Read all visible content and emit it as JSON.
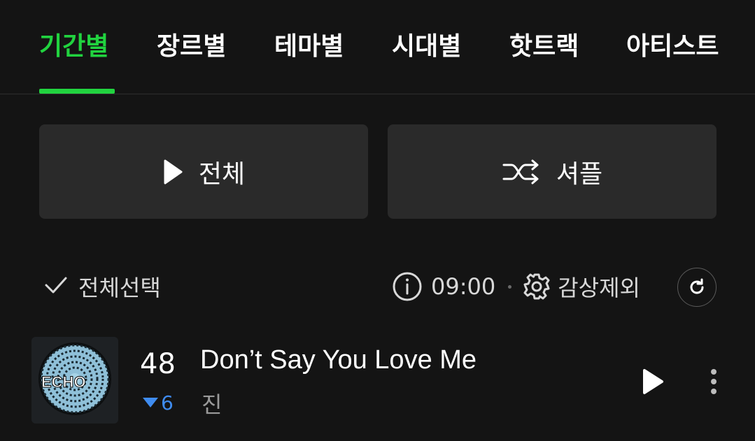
{
  "tabs": [
    {
      "label": "기간별",
      "active": true
    },
    {
      "label": "장르별",
      "active": false
    },
    {
      "label": "테마별",
      "active": false
    },
    {
      "label": "시대별",
      "active": false
    },
    {
      "label": "핫트랙",
      "active": false
    },
    {
      "label": "아티스트",
      "active": false
    }
  ],
  "actions": {
    "play_all_label": "전체",
    "shuffle_label": "셔플"
  },
  "select_row": {
    "select_all_label": "전체선택",
    "time": "09:00",
    "exclude_label": "감상제외"
  },
  "tracks": [
    {
      "rank": "48",
      "rank_change": "6",
      "rank_change_direction": "down",
      "title": "Don’t Say You Love Me",
      "artist": "진",
      "album_art_text": "ECHO"
    }
  ],
  "colors": {
    "accent": "#21d33f",
    "background": "#141414",
    "button_bg": "#2a2a2a",
    "rank_down": "#3f8cf0"
  },
  "icons": {
    "play_all": "play-icon",
    "shuffle": "shuffle-icon",
    "select_all": "check-icon",
    "info": "info-icon",
    "exclude": "gear-icon",
    "refresh": "refresh-icon",
    "track_play": "play-icon",
    "more": "more-vertical-icon"
  }
}
